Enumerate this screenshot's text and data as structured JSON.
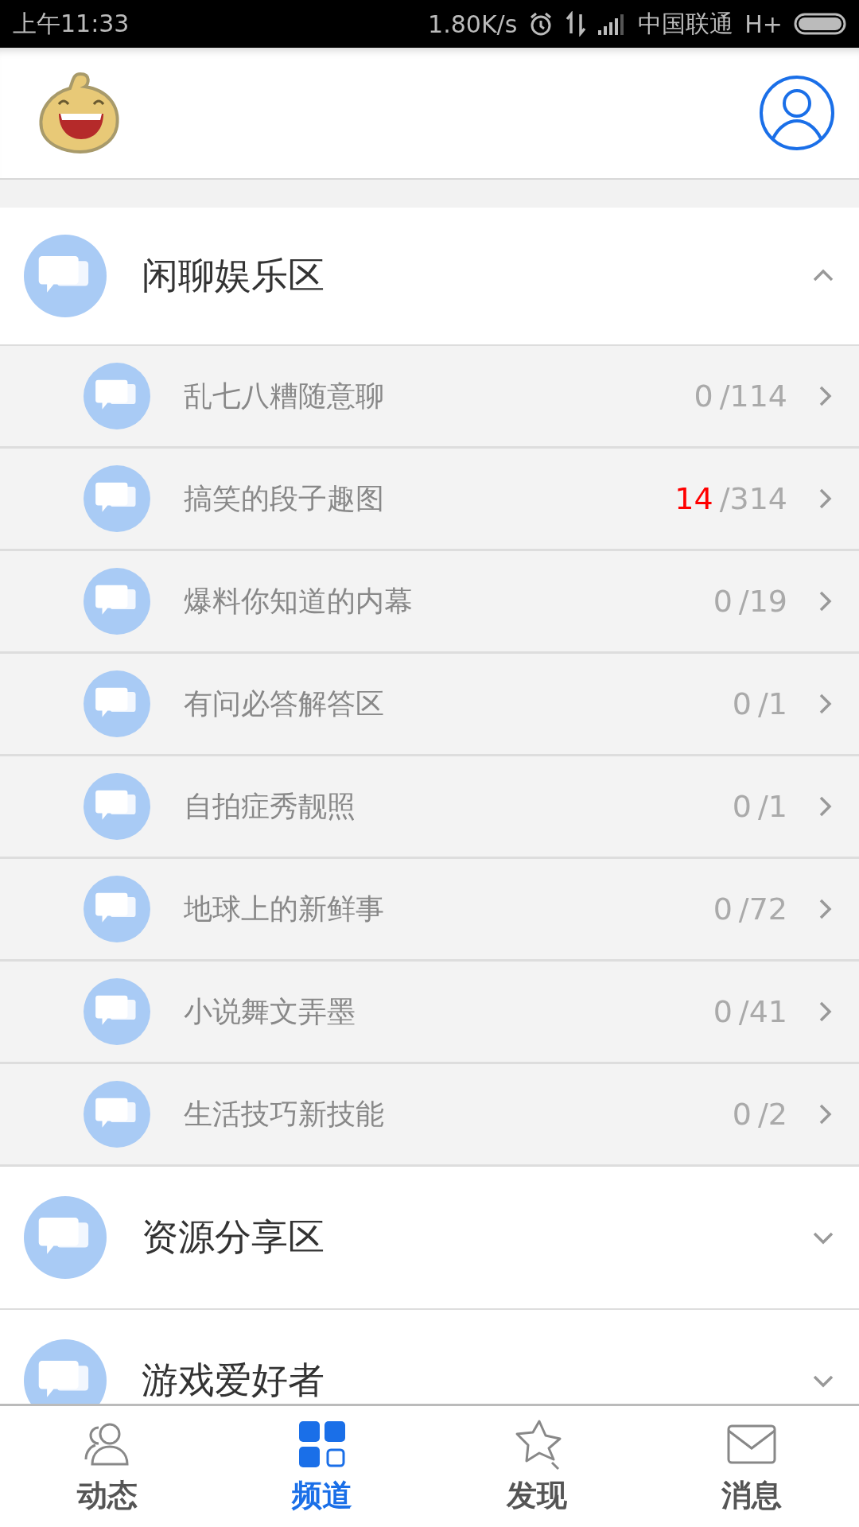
{
  "status_bar": {
    "time": "上午11:33",
    "speed": "1.80K/s",
    "carrier": "中国联通",
    "network": "H+"
  },
  "sections": [
    {
      "title": "闲聊娱乐区",
      "expanded": true,
      "forums": [
        {
          "name": "乱七八糟随意聊",
          "new": "0",
          "total": "/114",
          "has_new": false
        },
        {
          "name": "搞笑的段子趣图",
          "new": "14",
          "total": "/314",
          "has_new": true
        },
        {
          "name": "爆料你知道的内幕",
          "new": "0",
          "total": "/19",
          "has_new": false
        },
        {
          "name": "有问必答解答区",
          "new": "0",
          "total": "/1",
          "has_new": false
        },
        {
          "name": "自拍症秀靓照",
          "new": "0",
          "total": "/1",
          "has_new": false
        },
        {
          "name": "地球上的新鲜事",
          "new": "0",
          "total": "/72",
          "has_new": false
        },
        {
          "name": "小说舞文弄墨",
          "new": "0",
          "total": "/41",
          "has_new": false
        },
        {
          "name": "生活技巧新技能",
          "new": "0",
          "total": "/2",
          "has_new": false
        }
      ]
    },
    {
      "title": "资源分享区",
      "expanded": false
    },
    {
      "title": "游戏爱好者",
      "expanded": false
    }
  ],
  "tabs": [
    {
      "kind": "people",
      "label": "动态",
      "selected": false
    },
    {
      "kind": "grid",
      "label": "频道",
      "selected": true
    },
    {
      "kind": "star",
      "label": "发现",
      "selected": false
    },
    {
      "kind": "mail",
      "label": "消息",
      "selected": false
    }
  ]
}
